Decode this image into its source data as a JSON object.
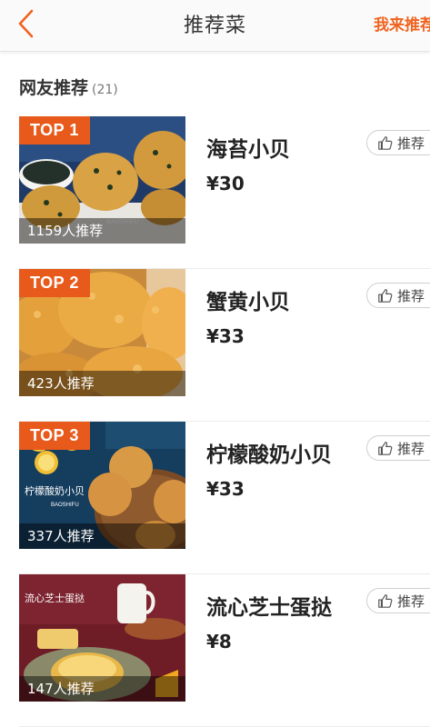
{
  "header": {
    "title": "推荐菜",
    "action_label": "我来推荐",
    "back_icon": "chevron-left-icon",
    "accent_color": "#f0631f"
  },
  "section": {
    "title": "网友推荐",
    "count": "(21)"
  },
  "dishes": [
    {
      "rank": "TOP 1",
      "name": "海苔小贝",
      "price": "¥30",
      "recommendations": "1159人推荐",
      "button_label": "推荐",
      "image": "seaweed-scallop-buns"
    },
    {
      "rank": "TOP 2",
      "name": "蟹黄小贝",
      "price": "¥33",
      "recommendations": "423人推荐",
      "button_label": "推荐",
      "image": "crab-roe-scallop-buns"
    },
    {
      "rank": "TOP 3",
      "name": "柠檬酸奶小贝",
      "price": "¥33",
      "recommendations": "337人推荐",
      "button_label": "推荐",
      "image": "lemon-yogurt-scallop-buns",
      "image_text": {
        "caption": "柠檬酸奶小贝",
        "brand": "BAOSHIFU"
      }
    },
    {
      "rank": "",
      "name": "流心芝士蛋挞",
      "price": "¥8",
      "recommendations": "147人推荐",
      "button_label": "推荐",
      "image": "molten-cheese-egg-tart",
      "image_text": {
        "caption": "流心芝士蛋挞"
      }
    }
  ],
  "dish1_brand": "BAOSHIFU",
  "dish3_brand": "BAOSHIFU"
}
